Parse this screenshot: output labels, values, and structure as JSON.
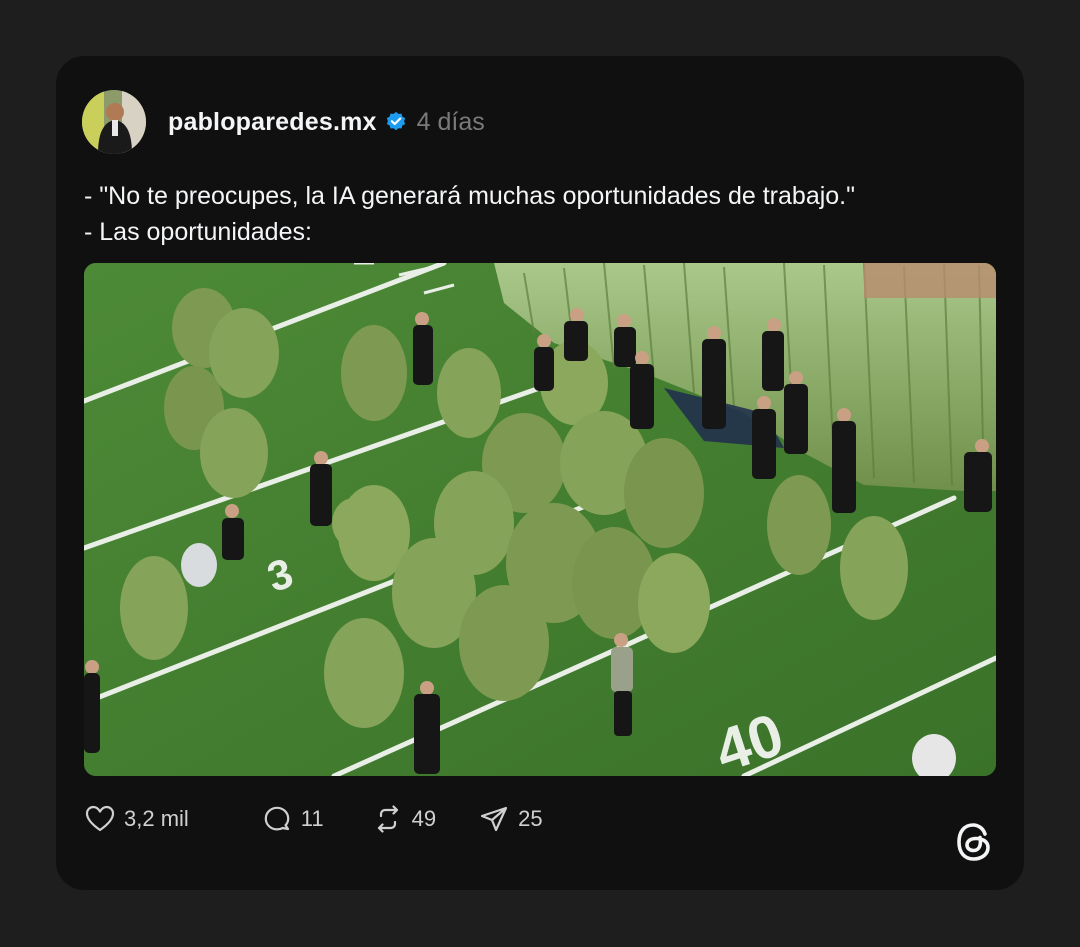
{
  "post": {
    "username": "pabloparedes.mx",
    "verified": true,
    "time": "4 días",
    "text_lines": [
      "- \"No te preocupes, la IA generará muchas oportunidades de trabajo.\"",
      "- Las oportunidades:"
    ],
    "media": {
      "field_number_1": "3",
      "field_number_2": "40"
    },
    "actions": {
      "likes": "3,2 mil",
      "comments": "11",
      "reposts": "49",
      "shares": "25"
    }
  },
  "icons": [
    "verified-badge-icon",
    "heart-icon",
    "comment-icon",
    "repost-icon",
    "share-icon",
    "threads-logo-icon"
  ],
  "colors": {
    "background": "#1e1e1e",
    "card": "#101010",
    "verified": "#1d9bf0",
    "time": "#7a7a7a",
    "field_green": "#3f7a2e"
  }
}
